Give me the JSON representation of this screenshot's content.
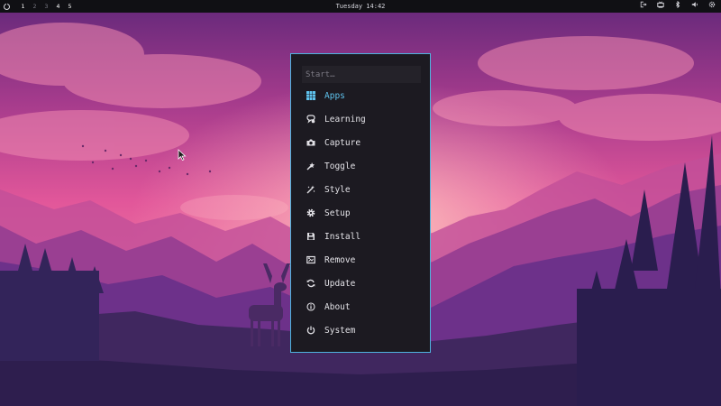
{
  "topbar": {
    "workspaces": [
      "1",
      "2",
      "3",
      "4",
      "5"
    ],
    "clock": "Tuesday 14:42",
    "tray_icons": [
      "logout-icon",
      "network-icon",
      "bluetooth-icon",
      "volume-icon",
      "settings-icon"
    ]
  },
  "menu": {
    "search_placeholder": "Start…",
    "items": [
      {
        "label": "Apps",
        "icon": "apps-grid-icon",
        "active": true
      },
      {
        "label": "Learning",
        "icon": "learning-icon"
      },
      {
        "label": "Capture",
        "icon": "camera-icon"
      },
      {
        "label": "Toggle",
        "icon": "toggle-icon"
      },
      {
        "label": "Style",
        "icon": "magic-wand-icon"
      },
      {
        "label": "Setup",
        "icon": "gear-icon"
      },
      {
        "label": "Install",
        "icon": "install-icon"
      },
      {
        "label": "Remove",
        "icon": "remove-icon"
      },
      {
        "label": "Update",
        "icon": "refresh-icon"
      },
      {
        "label": "About",
        "icon": "info-icon"
      },
      {
        "label": "System",
        "icon": "power-icon"
      }
    ],
    "accent_color": "#4fb3dd"
  },
  "wallpaper": {
    "sky_colors": [
      "#6e2d7a",
      "#e8559a",
      "#f07aa2"
    ],
    "mountain_colors": [
      "#b6489a",
      "#8a3c8e",
      "#5a2f7c",
      "#3c2468"
    ]
  }
}
